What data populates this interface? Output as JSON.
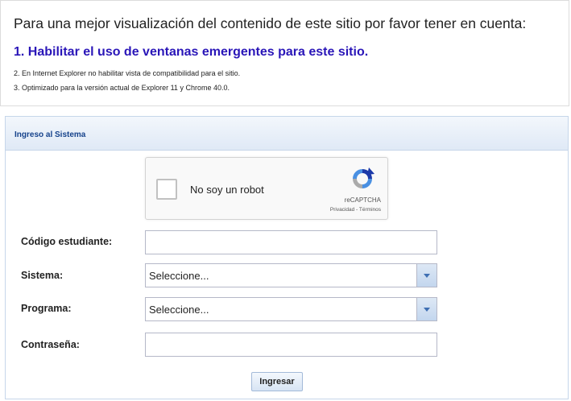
{
  "notice": {
    "headline": "Para una mejor visualización del contenido de este sitio por favor tener en cuenta:",
    "item1": "1. Habilitar el uso de ventanas emergentes para este sitio.",
    "item2": "2. En Internet Explorer no habilitar vista de compatibilidad para el sitio.",
    "item3": "3. Optimizado para la versión actual de Explorer 11 y Chrome 40.0."
  },
  "panel": {
    "title": "Ingreso al Sistema"
  },
  "captcha": {
    "checkbox_label": "No soy un robot",
    "brand": "reCAPTCHA",
    "privacy": "Privacidad",
    "separator": " - ",
    "terms": "Términos",
    "checked": false
  },
  "form": {
    "codigo": {
      "label": "Código estudiante:",
      "value": ""
    },
    "sistema": {
      "label": "Sistema:",
      "value": "Seleccione..."
    },
    "programa": {
      "label": "Programa:",
      "value": "Seleccione..."
    },
    "contrasena": {
      "label": "Contraseña:",
      "value": ""
    },
    "submit_label": "Ingresar"
  },
  "colors": {
    "highlight": "#2a16b8",
    "panel_header_text": "#15428b",
    "panel_border": "#c6d6ea"
  },
  "icons": {
    "captcha_logo": "recaptcha-logo-icon",
    "dropdown": "chevron-down-icon"
  }
}
